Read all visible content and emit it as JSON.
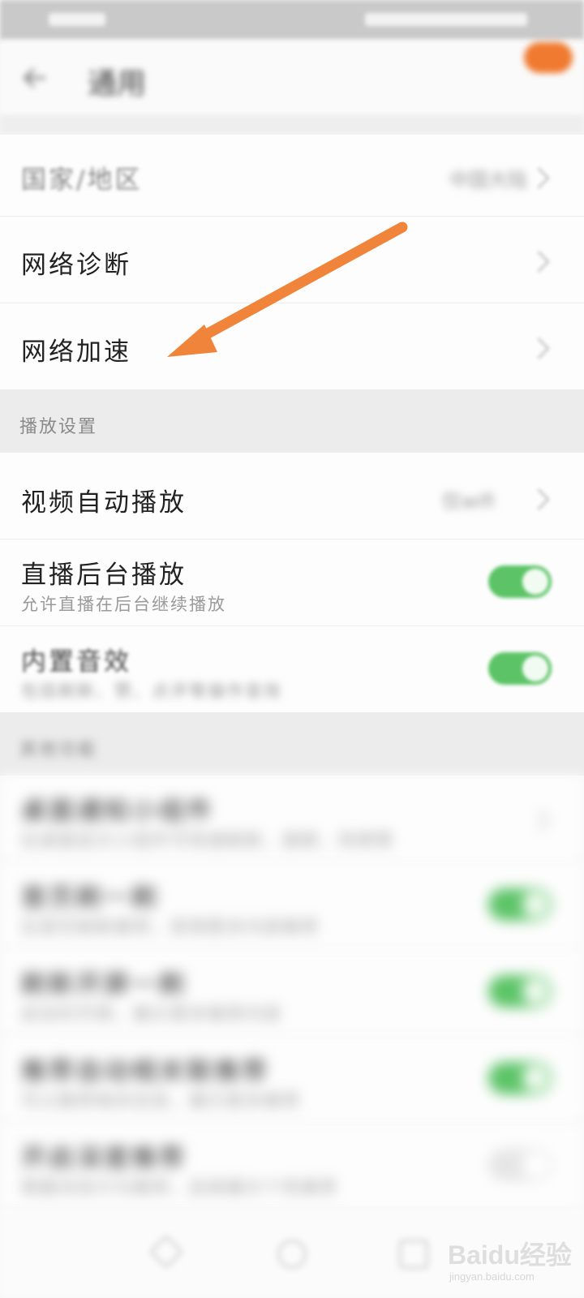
{
  "header": {
    "title": "通用"
  },
  "rows": {
    "country": {
      "label": "国家/地区",
      "value": "中国大陆"
    },
    "diagnose": {
      "label": "网络诊断"
    },
    "accelerate": {
      "label": "网络加速"
    }
  },
  "sections": {
    "playback": "播放设置",
    "other": "其他功能"
  },
  "playback": {
    "autoplay": {
      "label": "视频自动播放",
      "value": "仅wifi"
    },
    "live_bg": {
      "label": "直播后台播放",
      "sub": "允许直播在后台继续播放",
      "on": true
    },
    "sound": {
      "label": "内置音效",
      "sub": "包括刷新、赞、点评等操作音效",
      "on": true
    }
  },
  "other": {
    "r1": {
      "label": "桌面通知小组件",
      "sub": "在桌面显示小组件可快速刷新、搜索、热榜等",
      "chevron": true
    },
    "r2": {
      "label": "首页刷一刷",
      "sub": "在首页刷新推荐，获得更多内容推荐",
      "on": true
    },
    "r3": {
      "label": "刷新开屏一刷",
      "sub": "启动时开屏，展示更多推荐内容",
      "on": true
    },
    "r4": {
      "label": "推荐自动相关联推荐",
      "sub": "可以推荐相关信息，展示更多推荐",
      "on": true
    },
    "r5": {
      "label": "开启深度推荐",
      "sub": "根据浏览行为推荐，后续展示个性推荐",
      "on": false
    }
  },
  "watermark": {
    "main": "Baidu经验",
    "sub": "jingyan.baidu.com"
  },
  "colors": {
    "accent": "#f0843a",
    "toggle_on": "#5cc467"
  }
}
